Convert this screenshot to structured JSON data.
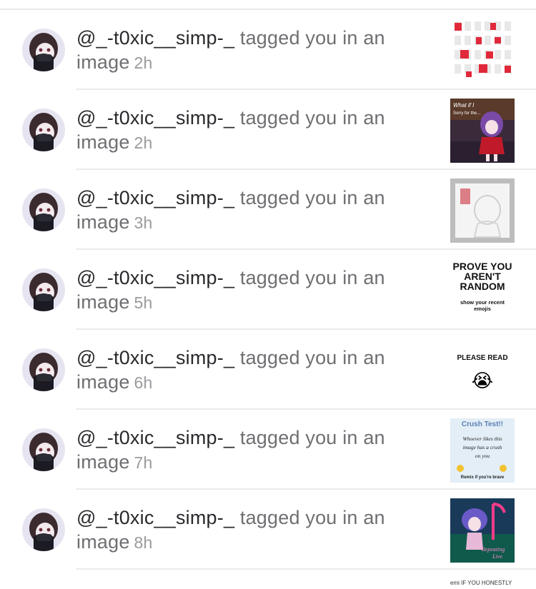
{
  "notifications": [
    {
      "username": "@_-t0xic__simp-_",
      "action": "tagged you in an",
      "object": "image",
      "time": "2h",
      "thumb": {
        "kind": "grid"
      }
    },
    {
      "username": "@_-t0xic__simp-_",
      "action": "tagged you in an",
      "object": "image",
      "time": "2h",
      "thumb": {
        "kind": "anime-dark",
        "lines": [
          "What if I",
          "Sorry for the..."
        ]
      }
    },
    {
      "username": "@_-t0xic__simp-_",
      "action": "tagged you in an",
      "object": "image",
      "time": "3h",
      "thumb": {
        "kind": "sketch"
      }
    },
    {
      "username": "@_-t0xic__simp-_",
      "action": "tagged you in an",
      "object": "image",
      "time": "5h",
      "thumb": {
        "kind": "text",
        "lines": [
          "PROVE YOU",
          "AREN'T",
          "RANDOM"
        ],
        "sub": [
          "show your recent",
          "emojis"
        ]
      }
    },
    {
      "username": "@_-t0xic__simp-_",
      "action": "tagged you in an",
      "object": "image",
      "time": "6h",
      "thumb": {
        "kind": "please",
        "lines": [
          "PLEASE READ"
        ],
        "emoji": "😭"
      }
    },
    {
      "username": "@_-t0xic__simp-_",
      "action": "tagged you in an",
      "object": "image",
      "time": "7h",
      "thumb": {
        "kind": "crush",
        "lines": [
          "Crush Test!!",
          "Whoever likes this",
          "image has a crush",
          "on you"
        ],
        "sub": [
          "Remix if you're brave"
        ]
      }
    },
    {
      "username": "@_-t0xic__simp-_",
      "action": "tagged you in an",
      "object": "image",
      "time": "8h",
      "thumb": {
        "kind": "anime-tiktok",
        "lines": [
          "Repeating",
          "Live"
        ]
      }
    }
  ],
  "partial_thumb_text": "emi IF YOU HONESTLY",
  "colors": {
    "username": "#2a2a2e",
    "action": "#6f6f73",
    "time": "#9a9a9e",
    "divider": "#ebebed"
  }
}
